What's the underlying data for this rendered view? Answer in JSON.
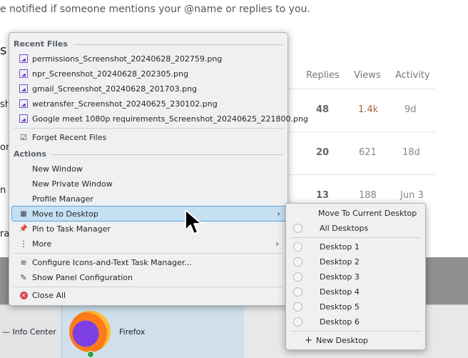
{
  "background": {
    "notice": "e notified if someone mentions your @name or replies to you.",
    "heading_fragment": "s",
    "columns": [
      "Replies",
      "Views",
      "Activity"
    ],
    "row_fragments": [
      "sh",
      "or",
      "n",
      "ra"
    ],
    "rows": [
      {
        "replies": "48",
        "views": "1.4k",
        "activity": "9d"
      },
      {
        "replies": "20",
        "views": "621",
        "activity": "18d"
      },
      {
        "replies": "13",
        "views": "188",
        "activity": "Jun 3"
      }
    ]
  },
  "menu": {
    "recent_files_title": "Recent Files",
    "recent_files": [
      "permissions_Screenshot_20240628_202759.png",
      "npr_Screenshot_20240628_202305.png",
      "gmail_Screenshot_20240628_201703.png",
      "wetransfer_Screenshot_20240625_230102.png",
      "Google meet 1080p requirements_Screenshot_20240625_221800.png"
    ],
    "forget_recent": "Forget Recent Files",
    "actions_title": "Actions",
    "actions": [
      "New Window",
      "New Private Window",
      "Profile Manager"
    ],
    "move_to_desktop": "Move to Desktop",
    "pin": "Pin to Task Manager",
    "more": "More",
    "configure": "Configure Icons-and-Text Task Manager...",
    "show_panel": "Show Panel Configuration",
    "close_all": "Close All"
  },
  "submenu": {
    "current": "Move To Current Desktop",
    "all": "All Desktops",
    "desktops": [
      "Desktop 1",
      "Desktop 2",
      "Desktop 3",
      "Desktop 4",
      "Desktop 5",
      "Desktop 6"
    ],
    "new_desktop": "New Desktop"
  },
  "taskbar": {
    "info_center": "— Info Center",
    "firefox": "Firefox"
  },
  "colors": {
    "highlight": "#c6e0f3",
    "highlight_border": "#5aa3db",
    "close_icon": "#da4453",
    "views_hot": "#a5673a"
  }
}
